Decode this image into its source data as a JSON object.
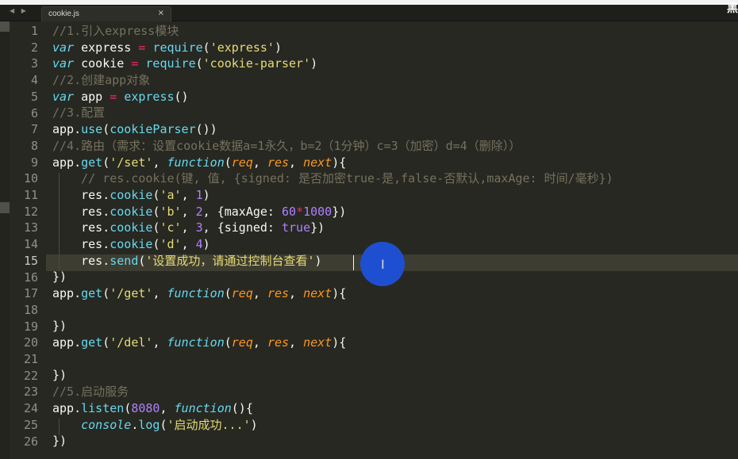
{
  "window": {
    "nav_arrows": "◀ ▶",
    "tab_label": "cookie.js",
    "tab_close": "×",
    "corner_text": "黑"
  },
  "editor": {
    "active_line": 15,
    "lines": [
      {
        "n": "1",
        "tokens": [
          {
            "t": "//1.引入express模块",
            "c": "cmt"
          }
        ]
      },
      {
        "n": "2",
        "tokens": [
          {
            "t": "var",
            "c": "kw"
          },
          {
            "t": " express ",
            "c": "plain"
          },
          {
            "t": "=",
            "c": "op"
          },
          {
            "t": " ",
            "c": "plain"
          },
          {
            "t": "require",
            "c": "fn"
          },
          {
            "t": "(",
            "c": "plain"
          },
          {
            "t": "'express'",
            "c": "str"
          },
          {
            "t": ")",
            "c": "plain"
          }
        ]
      },
      {
        "n": "3",
        "tokens": [
          {
            "t": "var",
            "c": "kw"
          },
          {
            "t": " cookie ",
            "c": "plain"
          },
          {
            "t": "=",
            "c": "op"
          },
          {
            "t": " ",
            "c": "plain"
          },
          {
            "t": "require",
            "c": "fn"
          },
          {
            "t": "(",
            "c": "plain"
          },
          {
            "t": "'cookie-parser'",
            "c": "str"
          },
          {
            "t": ")",
            "c": "plain"
          }
        ]
      },
      {
        "n": "4",
        "tokens": [
          {
            "t": "//2.创建app对象",
            "c": "cmt"
          }
        ]
      },
      {
        "n": "5",
        "tokens": [
          {
            "t": "var",
            "c": "kw"
          },
          {
            "t": " app ",
            "c": "plain"
          },
          {
            "t": "=",
            "c": "op"
          },
          {
            "t": " ",
            "c": "plain"
          },
          {
            "t": "express",
            "c": "fn"
          },
          {
            "t": "()",
            "c": "plain"
          }
        ]
      },
      {
        "n": "6",
        "tokens": [
          {
            "t": "//3.配置",
            "c": "cmt"
          }
        ]
      },
      {
        "n": "7",
        "tokens": [
          {
            "t": "app.",
            "c": "plain"
          },
          {
            "t": "use",
            "c": "fn"
          },
          {
            "t": "(",
            "c": "plain"
          },
          {
            "t": "cookieParser",
            "c": "fn"
          },
          {
            "t": "())",
            "c": "plain"
          }
        ]
      },
      {
        "n": "8",
        "tokens": [
          {
            "t": "//4.路由（需求：设置cookie数据a=1永久，b=2（1分钟）c=3（加密）d=4（删除））",
            "c": "cmt"
          }
        ]
      },
      {
        "n": "9",
        "tokens": [
          {
            "t": "app.",
            "c": "plain"
          },
          {
            "t": "get",
            "c": "fn"
          },
          {
            "t": "(",
            "c": "plain"
          },
          {
            "t": "'/set'",
            "c": "str"
          },
          {
            "t": ", ",
            "c": "plain"
          },
          {
            "t": "function",
            "c": "kw"
          },
          {
            "t": "(",
            "c": "plain"
          },
          {
            "t": "req",
            "c": "param"
          },
          {
            "t": ", ",
            "c": "plain"
          },
          {
            "t": "res",
            "c": "param"
          },
          {
            "t": ", ",
            "c": "plain"
          },
          {
            "t": "next",
            "c": "param"
          },
          {
            "t": "){",
            "c": "plain"
          }
        ]
      },
      {
        "n": "10",
        "tokens": [
          {
            "t": "    // res.cookie(键, 值, {signed: 是否加密true-是,false-否默认,maxAge: 时间/毫秒})",
            "c": "cmt"
          }
        ]
      },
      {
        "n": "11",
        "tokens": [
          {
            "t": "    res.",
            "c": "plain"
          },
          {
            "t": "cookie",
            "c": "fn"
          },
          {
            "t": "(",
            "c": "plain"
          },
          {
            "t": "'a'",
            "c": "str"
          },
          {
            "t": ", ",
            "c": "plain"
          },
          {
            "t": "1",
            "c": "num"
          },
          {
            "t": ")",
            "c": "plain"
          }
        ]
      },
      {
        "n": "12",
        "tokens": [
          {
            "t": "    res.",
            "c": "plain"
          },
          {
            "t": "cookie",
            "c": "fn"
          },
          {
            "t": "(",
            "c": "plain"
          },
          {
            "t": "'b'",
            "c": "str"
          },
          {
            "t": ", ",
            "c": "plain"
          },
          {
            "t": "2",
            "c": "num"
          },
          {
            "t": ", {maxAge: ",
            "c": "plain"
          },
          {
            "t": "60",
            "c": "num"
          },
          {
            "t": "*",
            "c": "op"
          },
          {
            "t": "1000",
            "c": "num"
          },
          {
            "t": "})",
            "c": "plain"
          }
        ]
      },
      {
        "n": "13",
        "tokens": [
          {
            "t": "    res.",
            "c": "plain"
          },
          {
            "t": "cookie",
            "c": "fn"
          },
          {
            "t": "(",
            "c": "plain"
          },
          {
            "t": "'c'",
            "c": "str"
          },
          {
            "t": ", ",
            "c": "plain"
          },
          {
            "t": "3",
            "c": "num"
          },
          {
            "t": ", {signed: ",
            "c": "plain"
          },
          {
            "t": "true",
            "c": "boolc"
          },
          {
            "t": "})",
            "c": "plain"
          }
        ]
      },
      {
        "n": "14",
        "tokens": [
          {
            "t": "    res.",
            "c": "plain"
          },
          {
            "t": "cookie",
            "c": "fn"
          },
          {
            "t": "(",
            "c": "plain"
          },
          {
            "t": "'d'",
            "c": "str"
          },
          {
            "t": ", ",
            "c": "plain"
          },
          {
            "t": "4",
            "c": "num"
          },
          {
            "t": ")",
            "c": "plain"
          }
        ]
      },
      {
        "n": "15",
        "tokens": [
          {
            "t": "    res.",
            "c": "plain"
          },
          {
            "t": "send",
            "c": "fn"
          },
          {
            "t": "(",
            "c": "plain"
          },
          {
            "t": "'设置成功，请通过控制台查看'",
            "c": "str"
          },
          {
            "t": ")",
            "c": "plain"
          }
        ]
      },
      {
        "n": "16",
        "tokens": [
          {
            "t": "})",
            "c": "plain"
          }
        ]
      },
      {
        "n": "17",
        "tokens": [
          {
            "t": "app.",
            "c": "plain"
          },
          {
            "t": "get",
            "c": "fn"
          },
          {
            "t": "(",
            "c": "plain"
          },
          {
            "t": "'/get'",
            "c": "str"
          },
          {
            "t": ", ",
            "c": "plain"
          },
          {
            "t": "function",
            "c": "kw"
          },
          {
            "t": "(",
            "c": "plain"
          },
          {
            "t": "req",
            "c": "param"
          },
          {
            "t": ", ",
            "c": "plain"
          },
          {
            "t": "res",
            "c": "param"
          },
          {
            "t": ", ",
            "c": "plain"
          },
          {
            "t": "next",
            "c": "param"
          },
          {
            "t": "){",
            "c": "plain"
          }
        ]
      },
      {
        "n": "18",
        "tokens": []
      },
      {
        "n": "19",
        "tokens": [
          {
            "t": "})",
            "c": "plain"
          }
        ]
      },
      {
        "n": "20",
        "tokens": [
          {
            "t": "app.",
            "c": "plain"
          },
          {
            "t": "get",
            "c": "fn"
          },
          {
            "t": "(",
            "c": "plain"
          },
          {
            "t": "'/del'",
            "c": "str"
          },
          {
            "t": ", ",
            "c": "plain"
          },
          {
            "t": "function",
            "c": "kw"
          },
          {
            "t": "(",
            "c": "plain"
          },
          {
            "t": "req",
            "c": "param"
          },
          {
            "t": ", ",
            "c": "plain"
          },
          {
            "t": "res",
            "c": "param"
          },
          {
            "t": ", ",
            "c": "plain"
          },
          {
            "t": "next",
            "c": "param"
          },
          {
            "t": "){",
            "c": "plain"
          }
        ]
      },
      {
        "n": "21",
        "tokens": []
      },
      {
        "n": "22",
        "tokens": [
          {
            "t": "})",
            "c": "plain"
          }
        ]
      },
      {
        "n": "23",
        "tokens": [
          {
            "t": "//5.启动服务",
            "c": "cmt"
          }
        ]
      },
      {
        "n": "24",
        "tokens": [
          {
            "t": "app.",
            "c": "plain"
          },
          {
            "t": "listen",
            "c": "fn"
          },
          {
            "t": "(",
            "c": "plain"
          },
          {
            "t": "8080",
            "c": "num"
          },
          {
            "t": ", ",
            "c": "plain"
          },
          {
            "t": "function",
            "c": "kw"
          },
          {
            "t": "(){",
            "c": "plain"
          }
        ]
      },
      {
        "n": "25",
        "tokens": [
          {
            "t": "    ",
            "c": "plain"
          },
          {
            "t": "console",
            "c": "kw"
          },
          {
            "t": ".",
            "c": "plain"
          },
          {
            "t": "log",
            "c": "fn"
          },
          {
            "t": "(",
            "c": "plain"
          },
          {
            "t": "'启动成功...'",
            "c": "str"
          },
          {
            "t": ")",
            "c": "plain"
          }
        ]
      },
      {
        "n": "26",
        "tokens": [
          {
            "t": "})",
            "c": "plain"
          }
        ]
      }
    ]
  },
  "mouse_cursor_icon": "ibeam-cursor-icon",
  "ibeam_glyph": "I"
}
